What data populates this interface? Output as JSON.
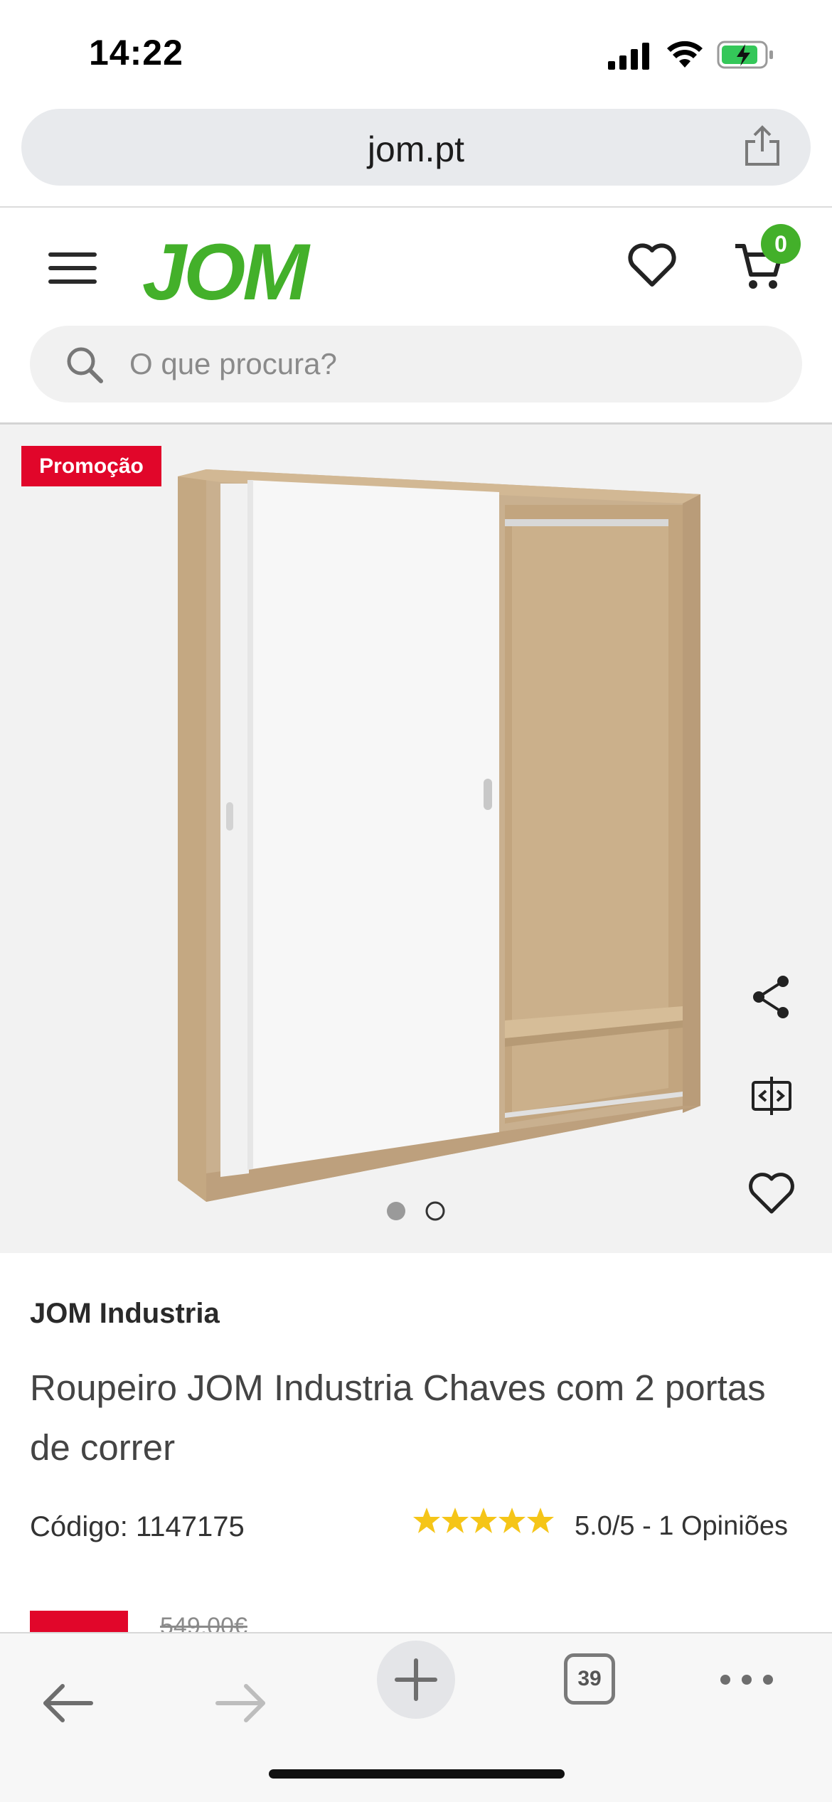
{
  "status_bar": {
    "time": "14:22",
    "battery_charging": true
  },
  "browser": {
    "url": "jom.pt"
  },
  "header": {
    "logo": "JOM",
    "cart_count": "0",
    "search_placeholder": "O que procura?"
  },
  "product": {
    "badge": "Promoção",
    "gallery_count": 2,
    "gallery_active_index": 1,
    "brand": "JOM Industria",
    "title": "Roupeiro JOM Industria Chaves com 2 portas de correr",
    "code": "Código: 1147175",
    "rating_stars": 5,
    "rating_text": "5.0/5 - 1 Opiniões",
    "old_price": "549,00€"
  },
  "toolbar": {
    "tabs_count": "39"
  },
  "colors": {
    "brand_green": "#43b02a",
    "promo_red": "#e1062a",
    "star_yellow": "#f5c518"
  },
  "icons": [
    "signal-icon",
    "wifi-icon",
    "battery-icon",
    "share-icon",
    "menu-icon",
    "heart-icon",
    "cart-icon",
    "search-icon",
    "compare-icon",
    "back-icon",
    "forward-icon",
    "plus-icon",
    "tabs-icon",
    "more-icon"
  ]
}
